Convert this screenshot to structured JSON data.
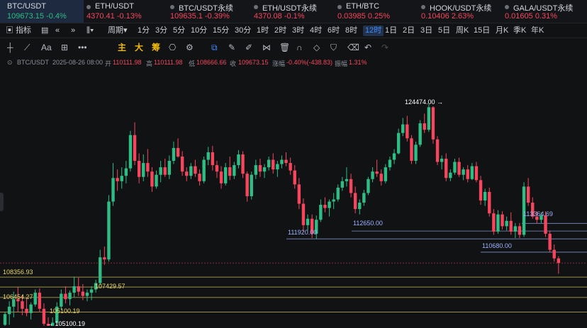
{
  "tickers": [
    {
      "name": "BTC/USDT",
      "price": "109673.15",
      "change": "-0.4%",
      "dir": "up",
      "active": true
    },
    {
      "name": "ETH/USDT",
      "price": "4370.41",
      "change": "-0.13%",
      "dir": "dn",
      "active": false
    },
    {
      "name": "BTC/USDT永续",
      "price": "109635.1",
      "change": "-0.39%",
      "dir": "dn",
      "active": false
    },
    {
      "name": "ETH/USDT永续",
      "price": "4370.08",
      "change": "-0.1%",
      "dir": "dn",
      "active": false
    },
    {
      "name": "ETH/BTC",
      "price": "0.03985",
      "change": "0.25%",
      "dir": "dn",
      "active": false
    },
    {
      "name": "HOOK/USDT永续",
      "price": "0.10406",
      "change": "2.63%",
      "dir": "dn",
      "active": false
    },
    {
      "name": "GALA/USDT永续",
      "price": "0.01605",
      "change": "0.31%",
      "dir": "dn",
      "active": false
    }
  ],
  "interval_bar": {
    "indicator_label": "指标",
    "period_label": "周期",
    "intervals": [
      "1分",
      "3分",
      "5分",
      "10分",
      "15分",
      "30分",
      "1时",
      "2时",
      "3时",
      "4时",
      "6时",
      "8时",
      "12时",
      "1日",
      "2日",
      "3日",
      "5日",
      "周K",
      "15日",
      "月K",
      "季K",
      "年K"
    ],
    "selected": "12时"
  },
  "drawing_tools": {
    "main_label": "主",
    "big_label": "大",
    "chip_label": "筹",
    "icons": [
      "crosshair-icon",
      "trend-line-icon",
      "text-tool-icon",
      "ruler-icon",
      "more-tools-icon",
      "camera-icon",
      "settings-icon",
      "layout-icon",
      "pencil-icon",
      "brush-icon",
      "pattern-icon",
      "delete-icon",
      "magnet-icon",
      "filter-icon",
      "eraser-icon",
      "undo-icon",
      "redo-icon"
    ]
  },
  "info_line": {
    "symbol": "BTC/USDT",
    "datetime": "2025-08-26 08:00",
    "open_label": "开",
    "open": "110111.98",
    "high_label": "高",
    "high": "110111.98",
    "low_label": "低",
    "low": "108666.66",
    "close_label": "收",
    "close": "109673.15",
    "change_label": "涨幅",
    "change": "-0.40%(-438.83)",
    "amp_label": "振幅",
    "amp": "1.31%"
  },
  "chart_data": {
    "type": "candlestick",
    "symbol": "BTC/USDT",
    "interval": "12时",
    "y_range": [
      104200,
      127200
    ],
    "candles": [
      [
        103900,
        105100,
        103100,
        104900
      ],
      [
        104900,
        106100,
        103900,
        105600
      ],
      [
        105600,
        107000,
        104600,
        106300
      ],
      [
        106300,
        107400,
        105100,
        106100
      ],
      [
        106100,
        106700,
        104800,
        105400
      ],
      [
        105400,
        106400,
        104700,
        105000
      ],
      [
        105000,
        106000,
        104400,
        105800
      ],
      [
        105800,
        107200,
        105600,
        106900
      ],
      [
        106900,
        107300,
        105100,
        105400
      ],
      [
        105400,
        105900,
        103700,
        104000
      ],
      [
        104000,
        104600,
        102200,
        102800
      ],
      [
        102800,
        104600,
        102500,
        104100
      ],
      [
        104100,
        106000,
        103800,
        105600
      ],
      [
        105600,
        107200,
        105300,
        106800
      ],
      [
        106800,
        107500,
        105900,
        106300
      ],
      [
        106300,
        107100,
        105700,
        106900
      ],
      [
        106900,
        108400,
        106500,
        107500
      ],
      [
        107500,
        108300,
        106600,
        107000
      ],
      [
        107000,
        107700,
        106200,
        106600
      ],
      [
        106600,
        107200,
        106100,
        106900
      ],
      [
        106900,
        107500,
        106200,
        107200
      ],
      [
        107200,
        108100,
        106900,
        107800
      ],
      [
        107800,
        110900,
        107600,
        110200
      ],
      [
        110200,
        111200,
        109500,
        110000
      ],
      [
        110000,
        116000,
        109800,
        115400
      ],
      [
        115400,
        119000,
        115000,
        117600
      ],
      [
        117600,
        118400,
        116400,
        117300
      ],
      [
        117300,
        118600,
        116600,
        117800
      ],
      [
        117800,
        119200,
        117100,
        118500
      ],
      [
        118500,
        122000,
        118200,
        121600
      ],
      [
        121600,
        122800,
        118800,
        119200
      ],
      [
        119200,
        119900,
        117100,
        117700
      ],
      [
        117700,
        119800,
        117300,
        119000
      ],
      [
        119000,
        120300,
        117700,
        118200
      ],
      [
        118200,
        118600,
        116300,
        116800
      ],
      [
        116800,
        118300,
        116600,
        117900
      ],
      [
        117900,
        119200,
        117200,
        118600
      ],
      [
        118600,
        119400,
        117700,
        117900
      ],
      [
        117900,
        119700,
        117500,
        119200
      ],
      [
        119200,
        121000,
        118900,
        120400
      ],
      [
        120400,
        121300,
        119500,
        119600
      ],
      [
        119600,
        120100,
        117800,
        118200
      ],
      [
        118200,
        118600,
        117300,
        117800
      ],
      [
        117800,
        119000,
        117500,
        118700
      ],
      [
        118700,
        119300,
        117700,
        118000
      ],
      [
        118000,
        118400,
        116900,
        117300
      ],
      [
        117300,
        119600,
        117100,
        119300
      ],
      [
        119300,
        120500,
        118800,
        120000
      ],
      [
        120000,
        120600,
        118300,
        118800
      ],
      [
        118800,
        119200,
        117600,
        118200
      ],
      [
        118200,
        118700,
        116600,
        117100
      ],
      [
        117100,
        119000,
        116900,
        118600
      ],
      [
        118600,
        119600,
        117400,
        117800
      ],
      [
        117800,
        119100,
        117500,
        118800
      ],
      [
        118800,
        120200,
        118500,
        119800
      ],
      [
        119800,
        120100,
        117600,
        118000
      ],
      [
        118000,
        118200,
        115400,
        115900
      ],
      [
        115900,
        118200,
        115600,
        117900
      ],
      [
        117900,
        119300,
        117500,
        118800
      ],
      [
        118800,
        119400,
        117700,
        118200
      ],
      [
        118200,
        118900,
        117600,
        118600
      ],
      [
        118600,
        119600,
        118300,
        119300
      ],
      [
        119300,
        119900,
        118000,
        118400
      ],
      [
        118400,
        119200,
        117700,
        118900
      ],
      [
        118900,
        119700,
        118500,
        119300
      ],
      [
        119300,
        120000,
        118700,
        119000
      ],
      [
        119000,
        119500,
        117900,
        118300
      ],
      [
        118300,
        118800,
        116600,
        117000
      ],
      [
        117000,
        117600,
        114700,
        115200
      ],
      [
        115200,
        115700,
        112600,
        113200
      ],
      [
        113200,
        114200,
        112700,
        113800
      ],
      [
        113800,
        114200,
        112000,
        112400
      ],
      [
        112400,
        114100,
        111920,
        113700
      ],
      [
        113700,
        115600,
        113500,
        115100
      ],
      [
        115100,
        115800,
        114400,
        114800
      ],
      [
        114800,
        115600,
        114000,
        115400
      ],
      [
        115400,
        116200,
        114700,
        115600
      ],
      [
        115600,
        117000,
        115400,
        116700
      ],
      [
        116700,
        117700,
        116400,
        117300
      ],
      [
        117300,
        118600,
        116800,
        117500
      ],
      [
        117500,
        118000,
        115800,
        116200
      ],
      [
        116200,
        116800,
        114300,
        114700
      ],
      [
        114700,
        115600,
        114200,
        115300
      ],
      [
        115300,
        116500,
        115000,
        116200
      ],
      [
        116200,
        117700,
        116000,
        117500
      ],
      [
        117500,
        118600,
        117200,
        118200
      ],
      [
        118200,
        119300,
        117700,
        118000
      ],
      [
        118000,
        118400,
        116900,
        117300
      ],
      [
        117300,
        118900,
        117100,
        118600
      ],
      [
        118600,
        119600,
        118300,
        119300
      ],
      [
        119300,
        120300,
        118900,
        119900
      ],
      [
        119900,
        122200,
        119800,
        121800
      ],
      [
        121800,
        123200,
        121500,
        122600
      ],
      [
        122600,
        123400,
        121000,
        121300
      ],
      [
        121300,
        121600,
        118900,
        119200
      ],
      [
        119200,
        121000,
        118900,
        120700
      ],
      [
        120700,
        123000,
        120500,
        122700
      ],
      [
        122700,
        123600,
        121800,
        122100
      ],
      [
        122100,
        124474,
        121900,
        124200
      ],
      [
        124200,
        124300,
        120800,
        121200
      ],
      [
        121200,
        121500,
        118800,
        119100
      ],
      [
        119100,
        119700,
        118400,
        119400
      ],
      [
        119400,
        119900,
        117300,
        117600
      ],
      [
        117600,
        118400,
        117300,
        118100
      ],
      [
        118100,
        119400,
        117900,
        119100
      ],
      [
        119100,
        119500,
        117700,
        117900
      ],
      [
        117900,
        118600,
        117400,
        118400
      ],
      [
        118400,
        118800,
        117200,
        117500
      ],
      [
        117500,
        119000,
        117400,
        118700
      ],
      [
        118700,
        119100,
        117200,
        117400
      ],
      [
        117400,
        117800,
        115100,
        115500
      ],
      [
        115500,
        116600,
        115000,
        116300
      ],
      [
        116300,
        116700,
        114000,
        114300
      ],
      [
        114300,
        114700,
        112300,
        112600
      ],
      [
        112600,
        114600,
        112400,
        114200
      ],
      [
        114200,
        114500,
        112800,
        113100
      ],
      [
        113100,
        114000,
        112700,
        113600
      ],
      [
        113600,
        114400,
        112300,
        112600
      ],
      [
        112600,
        113400,
        112000,
        113100
      ],
      [
        113100,
        113400,
        112000,
        112300
      ],
      [
        112300,
        117200,
        112100,
        116800
      ],
      [
        116800,
        117600,
        115000,
        115300
      ],
      [
        115300,
        115800,
        113800,
        114000
      ],
      [
        114000,
        114500,
        113364.69,
        113700
      ],
      [
        113700,
        114400,
        113400,
        114100
      ],
      [
        114100,
        114500,
        112100,
        112400
      ],
      [
        112400,
        112700,
        110680,
        110900
      ],
      [
        110900,
        111400,
        109800,
        110100
      ],
      [
        110100,
        110300,
        108666.66,
        109673.15
      ]
    ],
    "levels": [
      {
        "price": 108356.93,
        "label": "108356.93",
        "color": "yellow"
      },
      {
        "price": 107429.57,
        "label": "107429.57",
        "color": "yellow"
      },
      {
        "price": 106454.27,
        "label": "106454.27",
        "color": "yellow"
      },
      {
        "price": 105100.19,
        "label": "105100.19",
        "color": "yellow"
      },
      {
        "price": 111920.0,
        "label": "111920.00",
        "color": "blue"
      },
      {
        "price": 112650.0,
        "label": "112650.00",
        "color": "blue"
      },
      {
        "price": 110680.0,
        "label": "110680.00",
        "color": "blue"
      },
      {
        "price": 113364.69,
        "label": "113364.69",
        "color": "blue"
      }
    ],
    "annotations": [
      {
        "label": "124474.00",
        "price": 124474,
        "kind": "high-marker"
      },
      {
        "label": "105100.19",
        "price": 105100.19,
        "kind": "low-marker"
      }
    ],
    "current_price": 109673.15,
    "colors": {
      "up": "#2ebd85",
      "down": "#f6465d",
      "level_yellow": "#e8d66a",
      "level_blue": "#8fa7e8",
      "background": "#111214"
    }
  }
}
